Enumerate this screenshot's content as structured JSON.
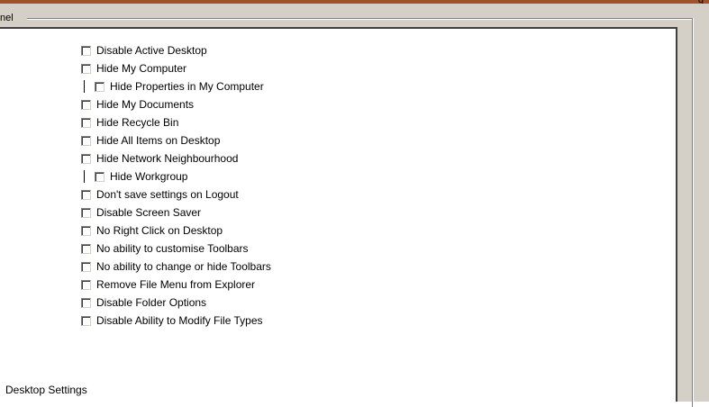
{
  "group": {
    "title_fragment": "nel",
    "top_fragment": "g"
  },
  "options": [
    {
      "label": "Disable Active Desktop",
      "checked": false,
      "indent": 0
    },
    {
      "label": "Hide My Computer",
      "checked": false,
      "indent": 0
    },
    {
      "label": "Hide Properties in My Computer",
      "checked": false,
      "indent": 1
    },
    {
      "label": "Hide My Documents",
      "checked": false,
      "indent": 0
    },
    {
      "label": "Hide Recycle Bin",
      "checked": false,
      "indent": 0
    },
    {
      "label": "Hide All Items on Desktop",
      "checked": false,
      "indent": 0
    },
    {
      "label": "Hide Network Neighbourhood",
      "checked": false,
      "indent": 0
    },
    {
      "label": "Hide Workgroup",
      "checked": false,
      "indent": 1
    },
    {
      "label": "Don't save settings on Logout",
      "checked": false,
      "indent": 0
    },
    {
      "label": "Disable Screen Saver",
      "checked": false,
      "indent": 0
    },
    {
      "label": "No Right Click on Desktop",
      "checked": false,
      "indent": 0
    },
    {
      "label": "No ability to customise Toolbars",
      "checked": false,
      "indent": 0
    },
    {
      "label": "No ability to change or hide Toolbars",
      "checked": false,
      "indent": 0
    },
    {
      "label": "Remove File Menu from Explorer",
      "checked": false,
      "indent": 0
    },
    {
      "label": "Disable Folder Options",
      "checked": false,
      "indent": 0
    },
    {
      "label": "Disable Ability to Modify File Types",
      "checked": false,
      "indent": 0
    }
  ],
  "status": {
    "label": "Desktop Settings"
  }
}
